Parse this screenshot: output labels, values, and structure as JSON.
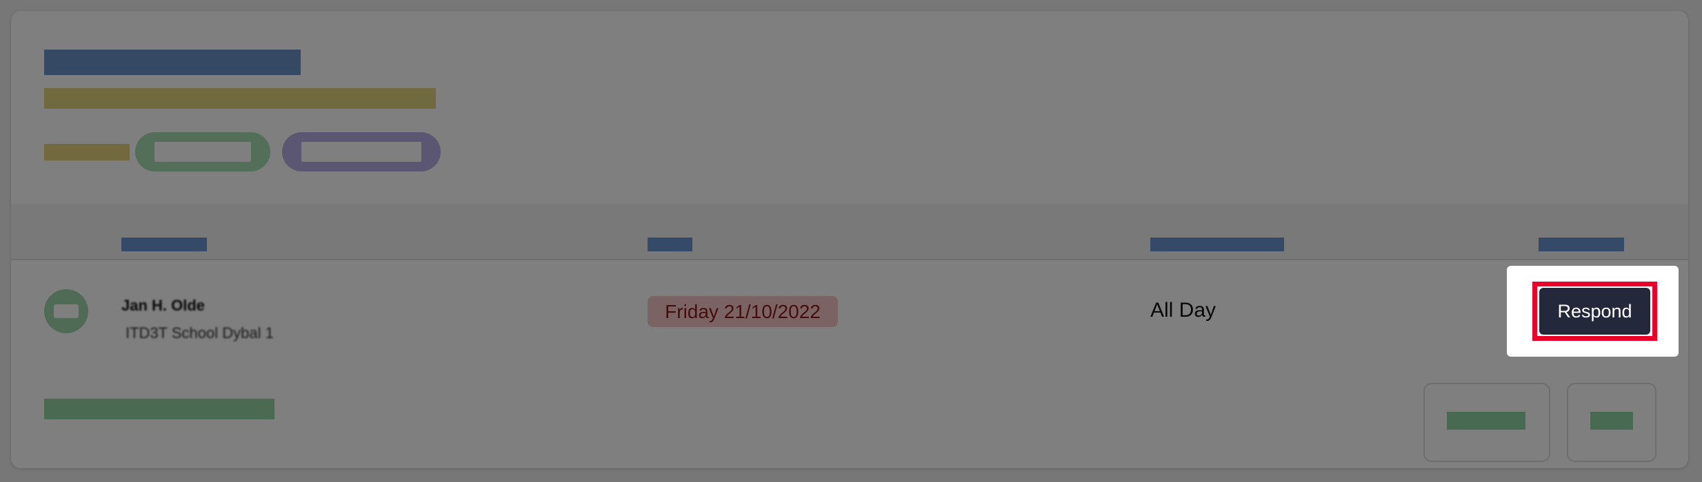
{
  "row": {
    "name": "Jan H. Olde",
    "subtitle": "ITD3T School Dybal 1",
    "date": "Friday 21/10/2022",
    "time": "All Day",
    "action_label": "Respond"
  },
  "colors": {
    "accent_highlight": "#e8002a",
    "button_bg": "#23293a",
    "date_badge_bg": "#f7c7c6",
    "date_badge_text": "#8a1c1c"
  }
}
